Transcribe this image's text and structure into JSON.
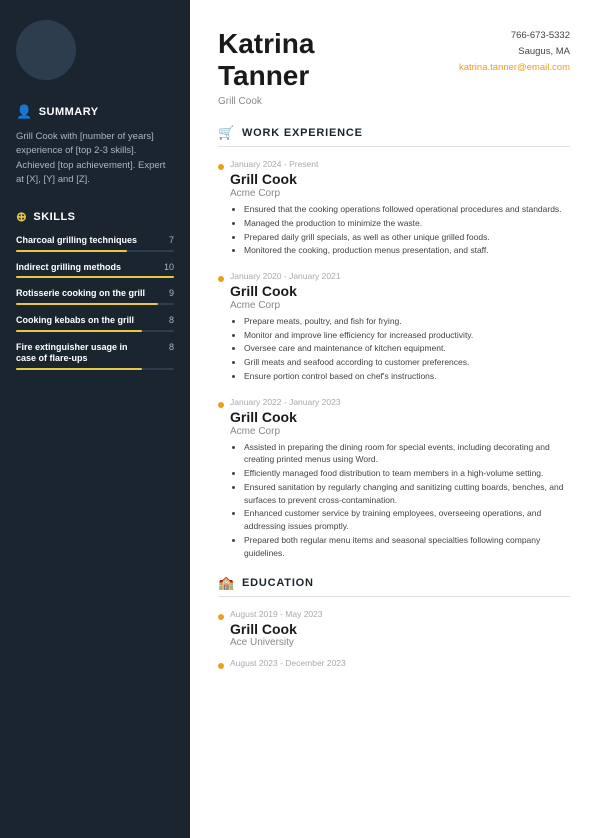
{
  "header": {
    "first_name": "Katrina",
    "last_name": "Tanner",
    "title": "Grill Cook",
    "phone": "766-673-5332",
    "location": "Saugus, MA",
    "email": "katrina.tanner@email.com"
  },
  "sidebar": {
    "summary_title": "Summary",
    "summary_icon": "👤",
    "summary_text": "Grill Cook with [number of years] experience of [top 2-3 skills]. Achieved [top achievement]. Expert at [X], [Y] and [Z].",
    "skills_title": "Skills",
    "skills_icon": "⊕",
    "skills": [
      {
        "name": "Charcoal grilling techniques",
        "score": 7,
        "pct": 70
      },
      {
        "name": "Indirect grilling methods",
        "score": 10,
        "pct": 100
      },
      {
        "name": "Rotisserie cooking on the grill",
        "score": 9,
        "pct": 90
      },
      {
        "name": "Cooking kebabs on the grill",
        "score": 8,
        "pct": 80
      },
      {
        "name": "Fire extinguisher usage in case of flare-ups",
        "score": 8,
        "pct": 80
      }
    ]
  },
  "work_experience": {
    "section_title": "Work Experience",
    "section_icon": "🏷",
    "jobs": [
      {
        "date": "January 2024 - Present",
        "title": "Grill Cook",
        "company": "Acme Corp",
        "bullets": [
          "Ensured that the cooking operations followed operational procedures and standards.",
          "Managed the production to minimize the waste.",
          "Prepared daily grill specials, as well as other unique grilled foods.",
          "Monitored the cooking, production menus presentation, and staff."
        ]
      },
      {
        "date": "January 2020 - January 2021",
        "title": "Grill Cook",
        "company": "Acme Corp",
        "bullets": [
          "Prepare meats, poultry, and fish for frying.",
          "Monitor and improve line efficiency for increased productivity.",
          "Oversee care and maintenance of kitchen equipment.",
          "Grill meats and seafood according to customer preferences.",
          "Ensure portion control based on chef's instructions."
        ]
      },
      {
        "date": "January 2022 - January 2023",
        "title": "Grill Cook",
        "company": "Acme Corp",
        "bullets": [
          "Assisted in preparing the dining room for special events, including decorating and creating printed menus using Word.",
          "Efficiently managed food distribution to team members in a high-volume setting.",
          "Ensured sanitation by regularly changing and sanitizing cutting boards, benches, and surfaces to prevent cross-contamination.",
          "Enhanced customer service by training employees, overseeing operations, and addressing issues promptly.",
          "Prepared both regular menu items and seasonal specialties following company guidelines."
        ]
      }
    ]
  },
  "education": {
    "section_title": "Education",
    "section_icon": "🏷",
    "entries": [
      {
        "date": "August 2019 - May 2023",
        "title": "Grill Cook",
        "school": "Ace University"
      },
      {
        "date": "August 2023 - December 2023",
        "title": "",
        "school": ""
      }
    ]
  }
}
